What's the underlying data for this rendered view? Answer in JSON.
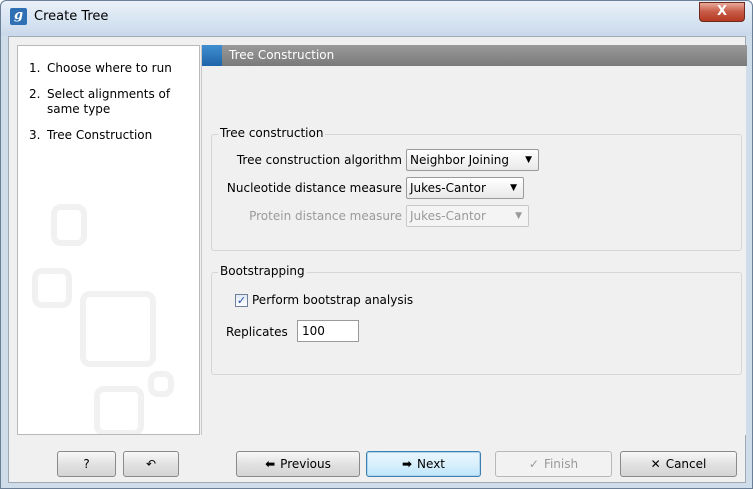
{
  "window": {
    "title": "Create Tree",
    "app_icon": "g",
    "close_label": "X"
  },
  "steps": [
    {
      "num": "1.",
      "label": "Choose where to run"
    },
    {
      "num": "2.",
      "label": "Select alignments of same type"
    },
    {
      "num": "3.",
      "label": "Tree Construction"
    }
  ],
  "section": {
    "title": "Tree Construction"
  },
  "tree_construction": {
    "group_title": "Tree construction",
    "algorithm_label": "Tree construction algorithm",
    "algorithm_value": "Neighbor Joining",
    "nucleotide_label": "Nucleotide distance measure",
    "nucleotide_value": "Jukes-Cantor",
    "protein_label": "Protein distance measure",
    "protein_value": "Jukes-Cantor"
  },
  "bootstrapping": {
    "group_title": "Bootstrapping",
    "perform_label": "Perform bootstrap analysis",
    "perform_checked": true,
    "replicates_label": "Replicates",
    "replicates_value": "100"
  },
  "buttons": {
    "help": "?",
    "reset": "↶",
    "previous": "Previous",
    "next": "Next",
    "finish": "Finish",
    "cancel": "Cancel"
  },
  "colors": {
    "accent": "#2f6fb3",
    "header": "#8a8a8a",
    "close": "#c75a45"
  }
}
